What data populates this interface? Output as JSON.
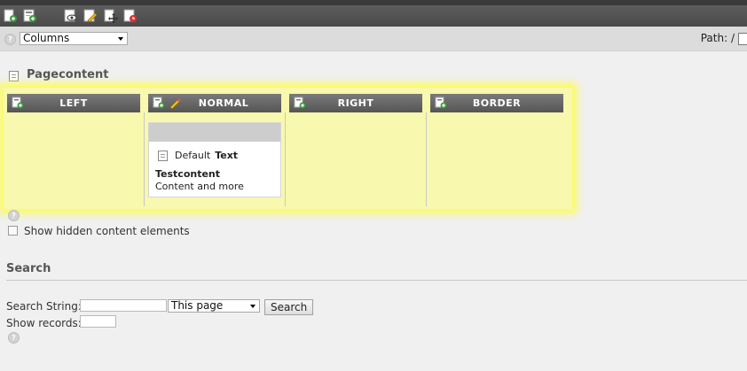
{
  "toolbar": {
    "icons": [
      "new-page-icon",
      "new-content-icon",
      "view-page-icon",
      "edit-page-icon",
      "move-page-icon",
      "page-history-icon"
    ]
  },
  "options": {
    "view_select": "Columns",
    "path_label": "Path: /"
  },
  "pagecontent": {
    "title": "Pagecontent",
    "columns": [
      {
        "label": "LEFT"
      },
      {
        "label": "NORMAL"
      },
      {
        "label": "RIGHT"
      },
      {
        "label": "BORDER"
      }
    ],
    "element": {
      "type_default": "Default",
      "type_name": "Text",
      "title": "Testcontent",
      "body": "Content and more"
    },
    "show_hidden_label": "Show hidden content elements"
  },
  "search": {
    "title": "Search",
    "string_label": "Search String:",
    "scope_select": "This page",
    "button_label": "Search",
    "records_label": "Show records:"
  },
  "colors": {
    "toolbar": "#4a4a4a",
    "column_header": "#555555",
    "highlight": "#ffff3c"
  }
}
